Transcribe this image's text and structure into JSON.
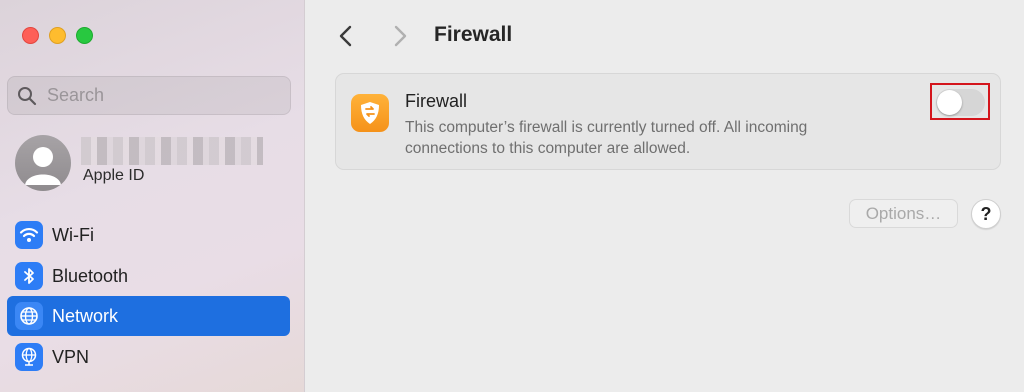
{
  "window": {
    "title": "Firewall"
  },
  "sidebar": {
    "search_placeholder": "Search",
    "account": {
      "label": "Apple ID"
    },
    "items": [
      {
        "label": "Wi-Fi",
        "icon": "wifi-icon",
        "active": false
      },
      {
        "label": "Bluetooth",
        "icon": "bluetooth-icon",
        "active": false
      },
      {
        "label": "Network",
        "icon": "globe-icon",
        "active": true
      },
      {
        "label": "VPN",
        "icon": "globe-icon",
        "active": false
      }
    ]
  },
  "firewall": {
    "title": "Firewall",
    "description": "This computer’s firewall is currently turned off. All incoming connections to this computer are allowed.",
    "enabled": false
  },
  "buttons": {
    "options": "Options…",
    "help": "?"
  },
  "colors": {
    "accent": "#1e6fe0",
    "highlight": "#d4151c",
    "firewall_icon": "#f5921a"
  }
}
